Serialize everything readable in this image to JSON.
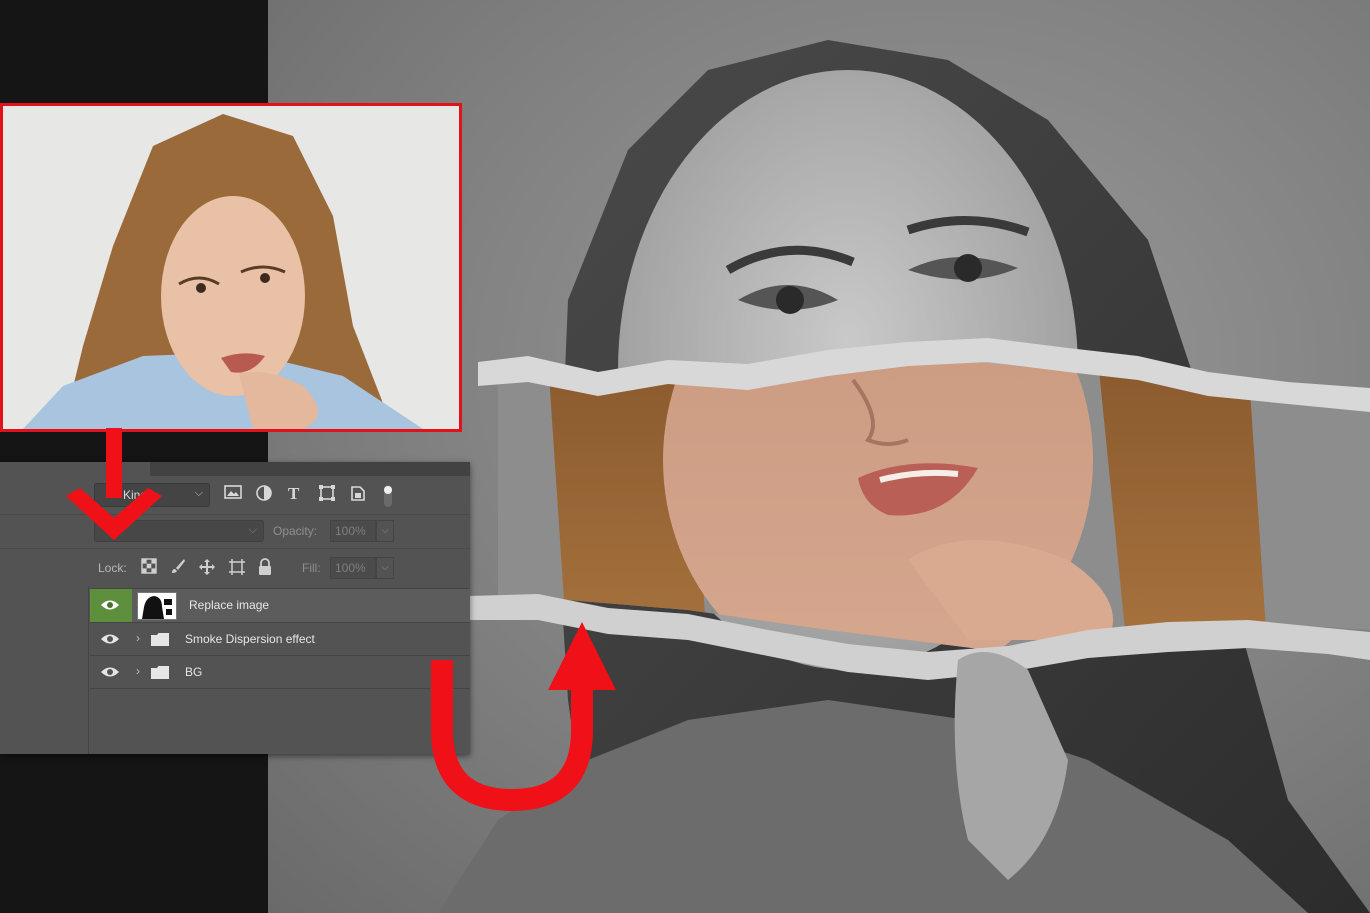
{
  "layers_panel": {
    "filter": {
      "kind_label": "Kind"
    },
    "opacity": {
      "label": "Opacity:",
      "value": "100%"
    },
    "lock": {
      "label": "Lock:"
    },
    "fill": {
      "label": "Fill:",
      "value": "100%"
    },
    "layers": [
      {
        "name": "Replace image",
        "type": "smart-object",
        "visible": true,
        "selected": true
      },
      {
        "name": "Smoke Dispersion effect",
        "type": "group",
        "visible": true,
        "selected": false
      },
      {
        "name": "BG",
        "type": "group",
        "visible": true,
        "selected": false
      }
    ]
  },
  "colors": {
    "accent_red": "#e1121a",
    "visibility_active_green": "#5e8f3c",
    "panel_bg": "#535353"
  },
  "icons": [
    "image-filter-icon",
    "adjustment-filter-icon",
    "type-filter-icon",
    "shape-filter-icon",
    "smart-object-filter-icon",
    "filter-toggle-icon",
    "lock-transparent-icon",
    "lock-paint-icon",
    "lock-position-icon",
    "lock-artboard-icon",
    "lock-all-icon",
    "eye-icon",
    "folder-icon",
    "chevron-right-icon"
  ]
}
